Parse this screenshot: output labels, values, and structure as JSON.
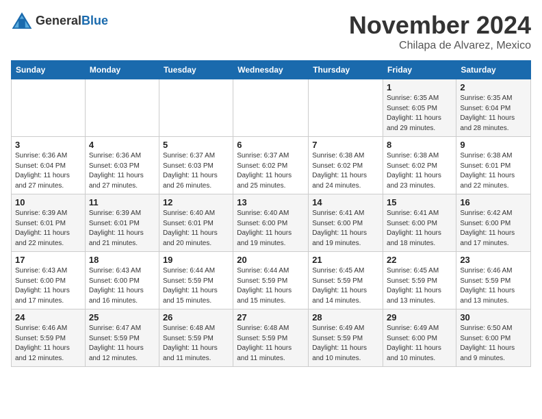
{
  "header": {
    "logo_general": "General",
    "logo_blue": "Blue",
    "month_title": "November 2024",
    "location": "Chilapa de Alvarez, Mexico"
  },
  "days_of_week": [
    "Sunday",
    "Monday",
    "Tuesday",
    "Wednesday",
    "Thursday",
    "Friday",
    "Saturday"
  ],
  "weeks": [
    [
      {
        "day": "",
        "sunrise": "",
        "sunset": "",
        "daylight": ""
      },
      {
        "day": "",
        "sunrise": "",
        "sunset": "",
        "daylight": ""
      },
      {
        "day": "",
        "sunrise": "",
        "sunset": "",
        "daylight": ""
      },
      {
        "day": "",
        "sunrise": "",
        "sunset": "",
        "daylight": ""
      },
      {
        "day": "",
        "sunrise": "",
        "sunset": "",
        "daylight": ""
      },
      {
        "day": "1",
        "sunrise": "Sunrise: 6:35 AM",
        "sunset": "Sunset: 6:05 PM",
        "daylight": "Daylight: 11 hours and 29 minutes."
      },
      {
        "day": "2",
        "sunrise": "Sunrise: 6:35 AM",
        "sunset": "Sunset: 6:04 PM",
        "daylight": "Daylight: 11 hours and 28 minutes."
      }
    ],
    [
      {
        "day": "3",
        "sunrise": "Sunrise: 6:36 AM",
        "sunset": "Sunset: 6:04 PM",
        "daylight": "Daylight: 11 hours and 27 minutes."
      },
      {
        "day": "4",
        "sunrise": "Sunrise: 6:36 AM",
        "sunset": "Sunset: 6:03 PM",
        "daylight": "Daylight: 11 hours and 27 minutes."
      },
      {
        "day": "5",
        "sunrise": "Sunrise: 6:37 AM",
        "sunset": "Sunset: 6:03 PM",
        "daylight": "Daylight: 11 hours and 26 minutes."
      },
      {
        "day": "6",
        "sunrise": "Sunrise: 6:37 AM",
        "sunset": "Sunset: 6:02 PM",
        "daylight": "Daylight: 11 hours and 25 minutes."
      },
      {
        "day": "7",
        "sunrise": "Sunrise: 6:38 AM",
        "sunset": "Sunset: 6:02 PM",
        "daylight": "Daylight: 11 hours and 24 minutes."
      },
      {
        "day": "8",
        "sunrise": "Sunrise: 6:38 AM",
        "sunset": "Sunset: 6:02 PM",
        "daylight": "Daylight: 11 hours and 23 minutes."
      },
      {
        "day": "9",
        "sunrise": "Sunrise: 6:38 AM",
        "sunset": "Sunset: 6:01 PM",
        "daylight": "Daylight: 11 hours and 22 minutes."
      }
    ],
    [
      {
        "day": "10",
        "sunrise": "Sunrise: 6:39 AM",
        "sunset": "Sunset: 6:01 PM",
        "daylight": "Daylight: 11 hours and 22 minutes."
      },
      {
        "day": "11",
        "sunrise": "Sunrise: 6:39 AM",
        "sunset": "Sunset: 6:01 PM",
        "daylight": "Daylight: 11 hours and 21 minutes."
      },
      {
        "day": "12",
        "sunrise": "Sunrise: 6:40 AM",
        "sunset": "Sunset: 6:01 PM",
        "daylight": "Daylight: 11 hours and 20 minutes."
      },
      {
        "day": "13",
        "sunrise": "Sunrise: 6:40 AM",
        "sunset": "Sunset: 6:00 PM",
        "daylight": "Daylight: 11 hours and 19 minutes."
      },
      {
        "day": "14",
        "sunrise": "Sunrise: 6:41 AM",
        "sunset": "Sunset: 6:00 PM",
        "daylight": "Daylight: 11 hours and 19 minutes."
      },
      {
        "day": "15",
        "sunrise": "Sunrise: 6:41 AM",
        "sunset": "Sunset: 6:00 PM",
        "daylight": "Daylight: 11 hours and 18 minutes."
      },
      {
        "day": "16",
        "sunrise": "Sunrise: 6:42 AM",
        "sunset": "Sunset: 6:00 PM",
        "daylight": "Daylight: 11 hours and 17 minutes."
      }
    ],
    [
      {
        "day": "17",
        "sunrise": "Sunrise: 6:43 AM",
        "sunset": "Sunset: 6:00 PM",
        "daylight": "Daylight: 11 hours and 17 minutes."
      },
      {
        "day": "18",
        "sunrise": "Sunrise: 6:43 AM",
        "sunset": "Sunset: 6:00 PM",
        "daylight": "Daylight: 11 hours and 16 minutes."
      },
      {
        "day": "19",
        "sunrise": "Sunrise: 6:44 AM",
        "sunset": "Sunset: 5:59 PM",
        "daylight": "Daylight: 11 hours and 15 minutes."
      },
      {
        "day": "20",
        "sunrise": "Sunrise: 6:44 AM",
        "sunset": "Sunset: 5:59 PM",
        "daylight": "Daylight: 11 hours and 15 minutes."
      },
      {
        "day": "21",
        "sunrise": "Sunrise: 6:45 AM",
        "sunset": "Sunset: 5:59 PM",
        "daylight": "Daylight: 11 hours and 14 minutes."
      },
      {
        "day": "22",
        "sunrise": "Sunrise: 6:45 AM",
        "sunset": "Sunset: 5:59 PM",
        "daylight": "Daylight: 11 hours and 13 minutes."
      },
      {
        "day": "23",
        "sunrise": "Sunrise: 6:46 AM",
        "sunset": "Sunset: 5:59 PM",
        "daylight": "Daylight: 11 hours and 13 minutes."
      }
    ],
    [
      {
        "day": "24",
        "sunrise": "Sunrise: 6:46 AM",
        "sunset": "Sunset: 5:59 PM",
        "daylight": "Daylight: 11 hours and 12 minutes."
      },
      {
        "day": "25",
        "sunrise": "Sunrise: 6:47 AM",
        "sunset": "Sunset: 5:59 PM",
        "daylight": "Daylight: 11 hours and 12 minutes."
      },
      {
        "day": "26",
        "sunrise": "Sunrise: 6:48 AM",
        "sunset": "Sunset: 5:59 PM",
        "daylight": "Daylight: 11 hours and 11 minutes."
      },
      {
        "day": "27",
        "sunrise": "Sunrise: 6:48 AM",
        "sunset": "Sunset: 5:59 PM",
        "daylight": "Daylight: 11 hours and 11 minutes."
      },
      {
        "day": "28",
        "sunrise": "Sunrise: 6:49 AM",
        "sunset": "Sunset: 5:59 PM",
        "daylight": "Daylight: 11 hours and 10 minutes."
      },
      {
        "day": "29",
        "sunrise": "Sunrise: 6:49 AM",
        "sunset": "Sunset: 6:00 PM",
        "daylight": "Daylight: 11 hours and 10 minutes."
      },
      {
        "day": "30",
        "sunrise": "Sunrise: 6:50 AM",
        "sunset": "Sunset: 6:00 PM",
        "daylight": "Daylight: 11 hours and 9 minutes."
      }
    ]
  ]
}
